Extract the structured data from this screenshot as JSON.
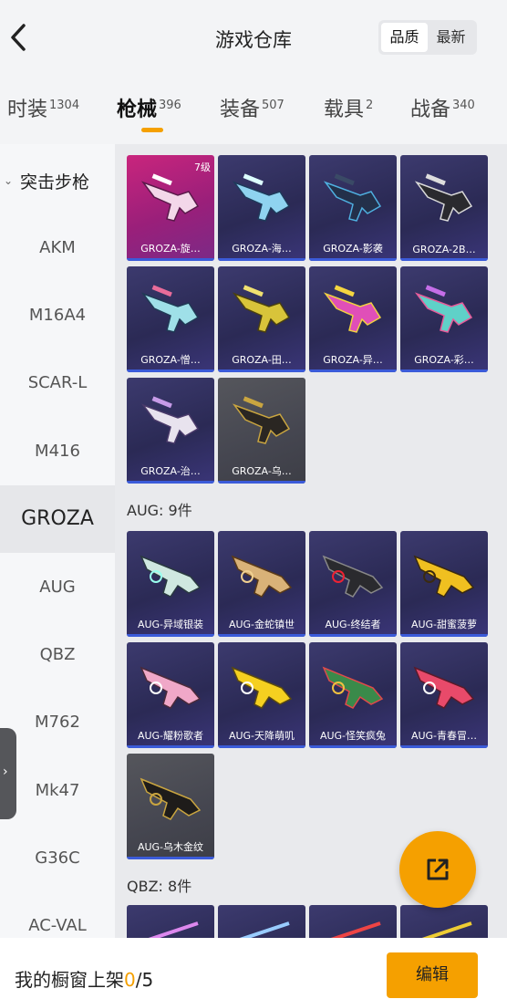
{
  "header": {
    "title": "游戏仓库",
    "back_icon": "chevron-left-icon",
    "sort_options": [
      "品质",
      "最新"
    ],
    "sort_active": "品质"
  },
  "tabs": [
    {
      "label": "时装",
      "count": "1304"
    },
    {
      "label": "枪械",
      "count": "396"
    },
    {
      "label": "装备",
      "count": "507"
    },
    {
      "label": "载具",
      "count": "2"
    },
    {
      "label": "战备",
      "count": "340"
    }
  ],
  "active_tab": "枪械",
  "sidebar": {
    "group": "突击步枪",
    "items": [
      "AKM",
      "M16A4",
      "SCAR-L",
      "M416",
      "GROZA",
      "AUG",
      "QBZ",
      "M762",
      "Mk47",
      "G36C",
      "AC-VAL"
    ],
    "active": "GROZA"
  },
  "groza_cards": [
    {
      "name": "GROZA-旋…",
      "level": "7级"
    },
    {
      "name": "GROZA-海…"
    },
    {
      "name": "GROZA-影袭"
    },
    {
      "name": "GROZA-2B…"
    },
    {
      "name": "GROZA-憎…"
    },
    {
      "name": "GROZA-田…"
    },
    {
      "name": "GROZA-异…"
    },
    {
      "name": "GROZA-彩…"
    },
    {
      "name": "GROZA-治…"
    },
    {
      "name": "GROZA-乌…"
    }
  ],
  "aug_section": "AUG: 9件",
  "aug_cards": [
    {
      "name": "AUG-异域银装"
    },
    {
      "name": "AUG-金蛇镇世"
    },
    {
      "name": "AUG-终结者"
    },
    {
      "name": "AUG-甜蜜菠萝"
    },
    {
      "name": "AUG-耀粉歌者"
    },
    {
      "name": "AUG-天降萌叽"
    },
    {
      "name": "AUG-怪笑疯兔"
    },
    {
      "name": "AUG-青春冒…"
    },
    {
      "name": "AUG-乌木金纹"
    }
  ],
  "qbz_section": "QBZ: 8件",
  "bottom": {
    "label": "我的橱窗上架",
    "current": "0",
    "total": "/5",
    "edit_label": "编辑"
  },
  "colors": {
    "accent": "#f5a000",
    "card_bg": "#2b2a55",
    "legendary": "#c9257d"
  }
}
